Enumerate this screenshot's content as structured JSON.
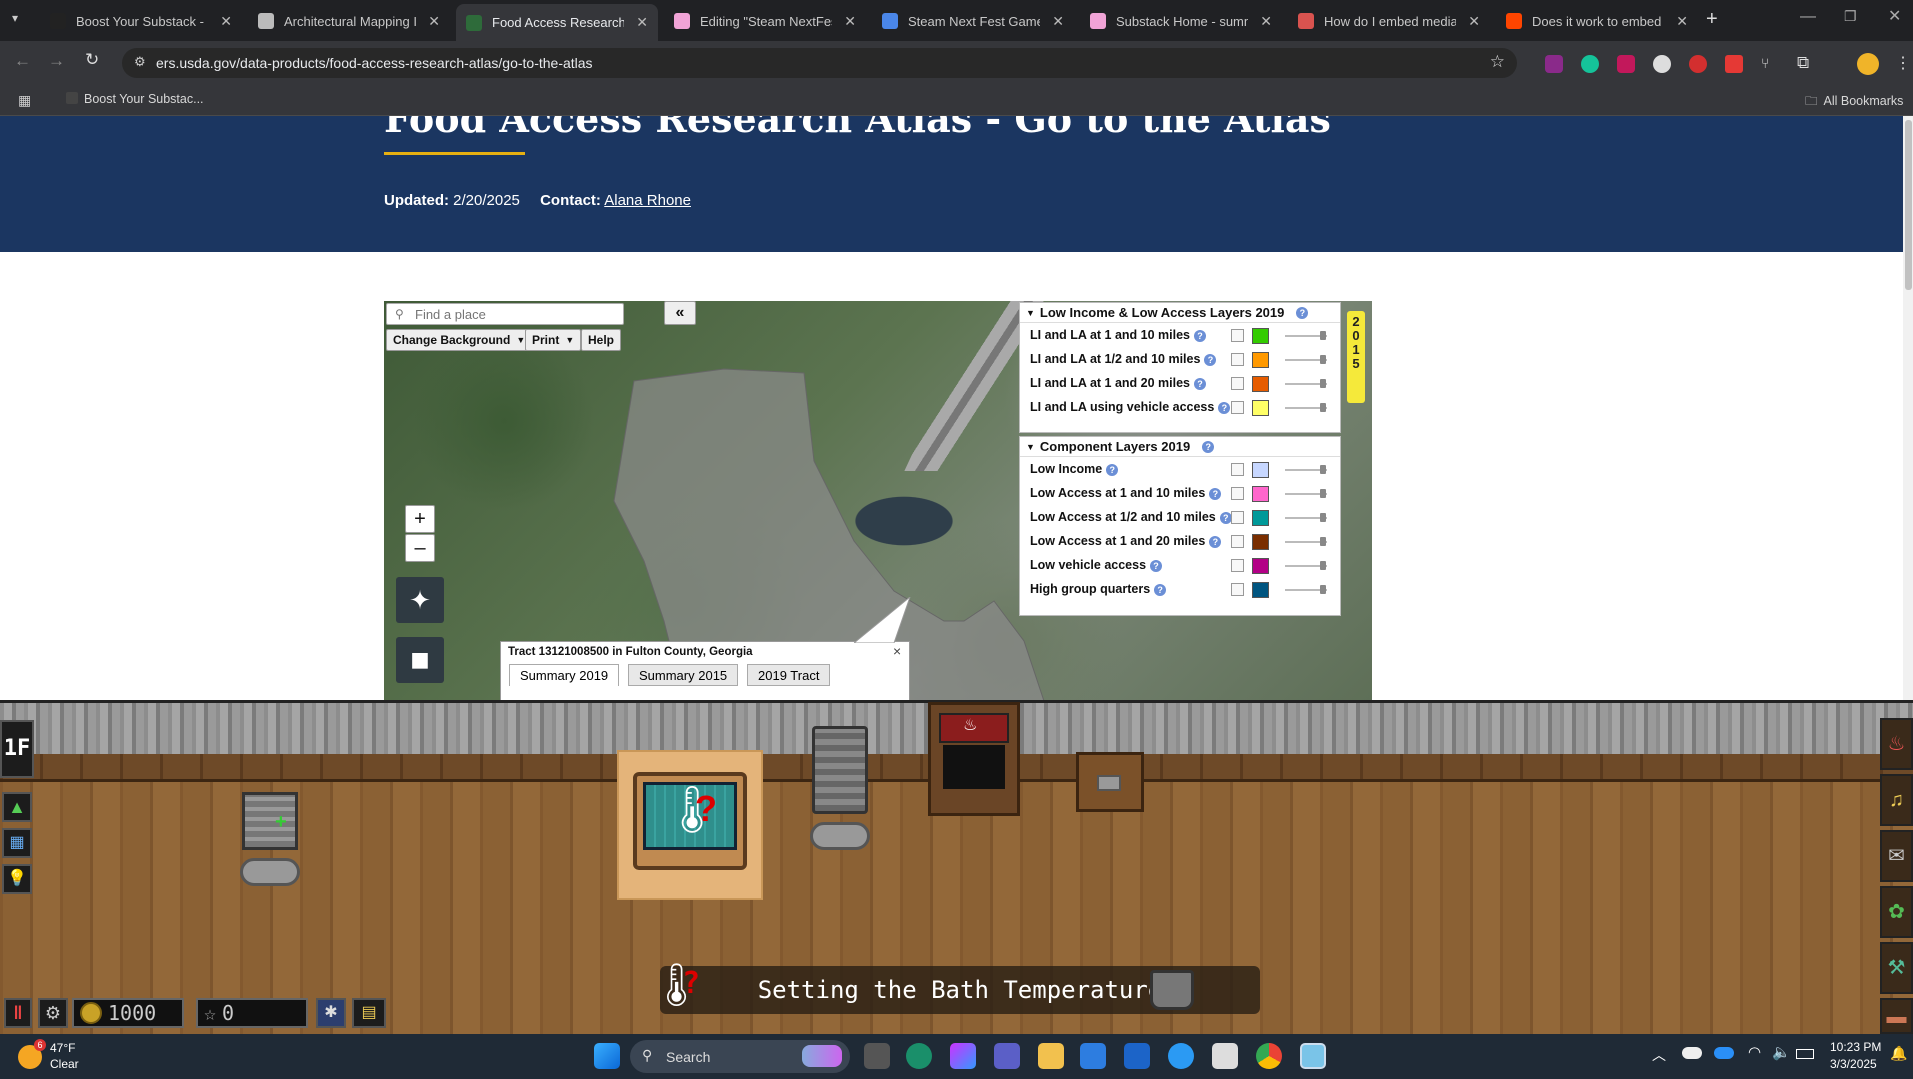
{
  "browser": {
    "tabs": [
      {
        "title": "Boost Your Substack - by",
        "color": "#222222"
      },
      {
        "title": "Architectural Mapping Ide",
        "color": "#bbbbbb"
      },
      {
        "title": "Food Access Research Atl",
        "color": "#2e6b3a"
      },
      {
        "title": "Editing \"Steam NextFest",
        "color": "#f0a3d6"
      },
      {
        "title": "Steam Next Fest Game De",
        "color": "#4a86e8"
      },
      {
        "title": "Substack Home - summer",
        "color": "#f0a3d6"
      },
      {
        "title": "How do I embed media in",
        "color": "#d9534f"
      },
      {
        "title": "Does it work to embed st",
        "color": "#ff4500"
      }
    ],
    "url": "ers.usda.gov/data-products/food-access-research-atlas/go-to-the-atlas",
    "bookmark": "Boost Your Substac...",
    "all_bookmarks": "All Bookmarks"
  },
  "page": {
    "title": "Food Access Research Atlas - Go to the Atlas",
    "updated_label": "Updated:",
    "updated_value": "2/20/2025",
    "contact_label": "Contact:",
    "contact_name": "Alana Rhone"
  },
  "map": {
    "search_placeholder": "Find a place",
    "collapse": "«",
    "change_background": "Change Background",
    "print": "Print",
    "help": "Help",
    "zoom_in": "+",
    "zoom_out": "–",
    "year_tab": "2015",
    "popup": {
      "title": "Tract 13121008500 in Fulton County, Georgia",
      "close": "×",
      "tabs": [
        "Summary 2019",
        "Summary 2015",
        "2019 Tract"
      ]
    },
    "legend_lila": {
      "header": "Low Income & Low Access Layers 2019",
      "rows": [
        {
          "label": "LI and LA at 1 and 10 miles",
          "color": "#33cc00"
        },
        {
          "label": "LI and LA at 1/2 and 10 miles",
          "color": "#ff9900"
        },
        {
          "label": "LI and LA at 1 and 20 miles",
          "color": "#e65c00"
        },
        {
          "label": "LI and LA using vehicle access",
          "color": "#ffff66"
        }
      ]
    },
    "legend_component": {
      "header": "Component Layers 2019",
      "rows": [
        {
          "label": "Low Income",
          "color": "#c7d7ff"
        },
        {
          "label": "Low Access at 1 and 10 miles",
          "color": "#ff66cc"
        },
        {
          "label": "Low Access at 1/2 and 10 miles",
          "color": "#009999"
        },
        {
          "label": "Low Access at 1 and 20 miles",
          "color": "#7a2e00"
        },
        {
          "label": "Low vehicle access",
          "color": "#b30086"
        },
        {
          "label": "High group quarters",
          "color": "#005580"
        }
      ]
    }
  },
  "game": {
    "floor_label": "1F",
    "coins": "1000",
    "stars": "0",
    "caption": "Setting the Bath Temperature"
  },
  "taskbar": {
    "weather_temp": "47°F",
    "weather_desc": "Clear",
    "weather_badge": "6",
    "search": "Search",
    "time": "10:23 PM",
    "date": "3/3/2025"
  }
}
